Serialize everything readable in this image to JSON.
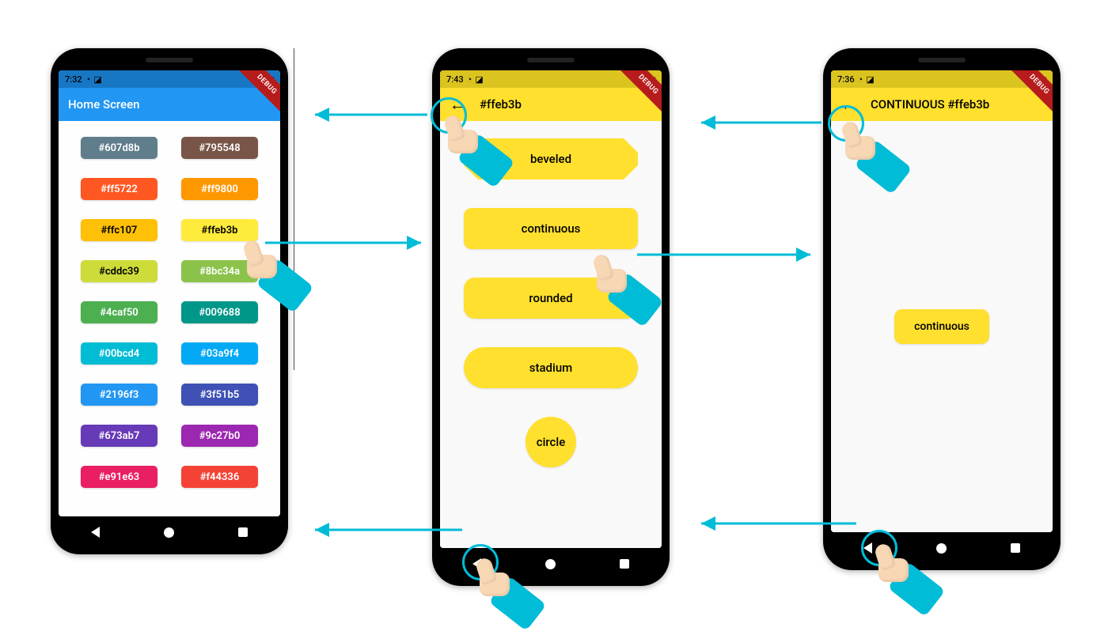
{
  "debug_label": "DEBUG",
  "phone1": {
    "status_time": "7:32",
    "app_title": "Home Screen",
    "colors": [
      {
        "hex": "#607d8b",
        "label": "#607d8b",
        "text": "light"
      },
      {
        "hex": "#795548",
        "label": "#795548",
        "text": "light"
      },
      {
        "hex": "#ff5722",
        "label": "#ff5722",
        "text": "light"
      },
      {
        "hex": "#ff9800",
        "label": "#ff9800",
        "text": "light"
      },
      {
        "hex": "#ffc107",
        "label": "#ffc107",
        "text": "dark"
      },
      {
        "hex": "#ffeb3b",
        "label": "#ffeb3b",
        "text": "dark"
      },
      {
        "hex": "#cddc39",
        "label": "#cddc39",
        "text": "dark"
      },
      {
        "hex": "#8bc34a",
        "label": "#8bc34a",
        "text": "light"
      },
      {
        "hex": "#4caf50",
        "label": "#4caf50",
        "text": "light"
      },
      {
        "hex": "#009688",
        "label": "#009688",
        "text": "light"
      },
      {
        "hex": "#00bcd4",
        "label": "#00bcd4",
        "text": "light"
      },
      {
        "hex": "#03a9f4",
        "label": "#03a9f4",
        "text": "light"
      },
      {
        "hex": "#2196f3",
        "label": "#2196f3",
        "text": "light"
      },
      {
        "hex": "#3f51b5",
        "label": "#3f51b5",
        "text": "light"
      },
      {
        "hex": "#673ab7",
        "label": "#673ab7",
        "text": "light"
      },
      {
        "hex": "#9c27b0",
        "label": "#9c27b0",
        "text": "light"
      },
      {
        "hex": "#e91e63",
        "label": "#e91e63",
        "text": "light"
      },
      {
        "hex": "#f44336",
        "label": "#f44336",
        "text": "light"
      }
    ]
  },
  "phone2": {
    "status_time": "7:43",
    "app_title": "#ffeb3b",
    "shapes": [
      {
        "label": "beveled",
        "class": "shape-beveled"
      },
      {
        "label": "continuous",
        "class": "shape-continuous"
      },
      {
        "label": "rounded",
        "class": "shape-rounded"
      },
      {
        "label": "stadium",
        "class": "shape-stadium"
      },
      {
        "label": "circle",
        "class": "shape-circle"
      }
    ]
  },
  "phone3": {
    "status_time": "7:36",
    "app_title": "CONTINUOUS #ffeb3b",
    "button_label": "continuous"
  },
  "yellow_hex": "#ffe02e",
  "arrow_color": "#00bcd7"
}
